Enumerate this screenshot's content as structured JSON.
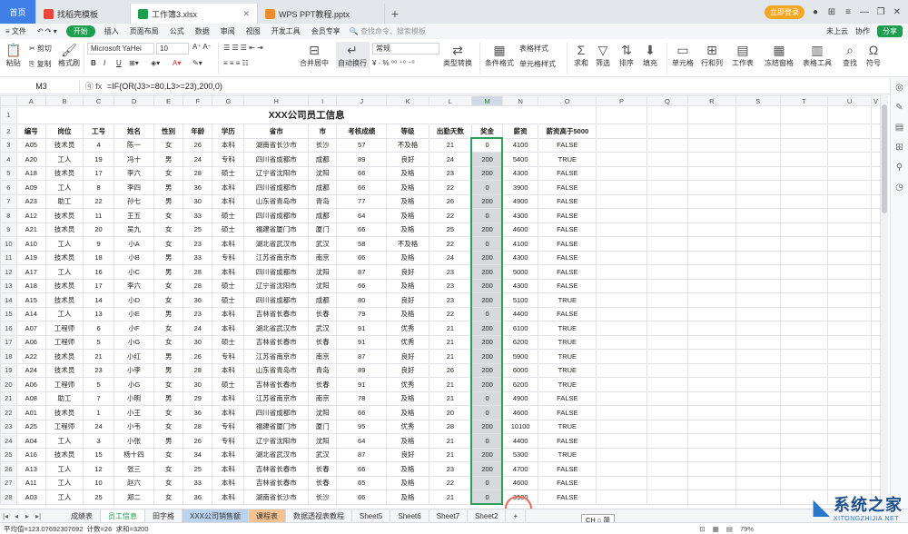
{
  "tabs": [
    {
      "label": "首页",
      "type": "home"
    },
    {
      "label": "找稻壳模板",
      "type": "doc",
      "color": "#e8453c"
    },
    {
      "label": "工作簿3.xlsx",
      "type": "sheet",
      "color": "#1e9e4f",
      "active": true
    },
    {
      "label": "WPS PPT教程.pptx",
      "type": "ppt",
      "color": "#f28b2b"
    }
  ],
  "new_tab": "+",
  "top_right": {
    "login": "立即登录",
    "icons": [
      "⊞",
      "≡",
      "—",
      "❐",
      "✕"
    ]
  },
  "menubar": {
    "file": "≡ 文件",
    "items": [
      "开始",
      "插入",
      "页面布局",
      "公式",
      "数据",
      "审阅",
      "视图",
      "开发工具",
      "会员专享"
    ],
    "search": "🔍 查找命令、搜索模板",
    "right": [
      "未上云",
      "协作",
      "分享"
    ]
  },
  "ribbon": {
    "paste": "粘贴",
    "cut": "✂ 剪切",
    "copy": "⎘ 复制",
    "format_painter": "格式刷",
    "font": "Microsoft YaHei",
    "size": "10",
    "bold": "B",
    "italic": "I",
    "underline": "U",
    "merge": "合并居中",
    "wrap": "自动换行",
    "numfmt": "常规",
    "pct": "¥ · % ⁰⁰ ⁺⁰ ⁻⁰",
    "convert": "类型转换",
    "cond": "条件格式",
    "cellstyle": "表格样式",
    "cellstyle2": "单元格样式",
    "sum": "求和",
    "filter": "筛选",
    "sort": "排序",
    "fill": "填充",
    "cell": "单元格",
    "rowcol": "行和列",
    "worksheet": "工作表",
    "freeze": "冻结窗格",
    "tabletools": "表格工具",
    "find": "查找",
    "symbol": "符号"
  },
  "formula_bar": {
    "name_box": "M3",
    "fx": "ⓠ  fx",
    "formula": "=IF(OR(J3>=80,L3>=23),200,0)"
  },
  "columns": [
    "A",
    "B",
    "C",
    "D",
    "E",
    "F",
    "G",
    "H",
    "I",
    "J",
    "K",
    "L",
    "M",
    "N",
    "O",
    "P",
    "Q",
    "R",
    "S",
    "T",
    "U",
    "V"
  ],
  "title": "XXX公司员工信息",
  "headers": [
    "编号",
    "岗位",
    "工号",
    "姓名",
    "性别",
    "年龄",
    "学历",
    "省市",
    "市",
    "考核成绩",
    "等级",
    "出勤天数",
    "奖金",
    "薪资",
    "薪资高于5000"
  ],
  "rows": [
    [
      "A05",
      "技术员",
      "4",
      "陈一",
      "女",
      "26",
      "本科",
      "湖南省长沙市",
      "长沙",
      "57",
      "不及格",
      "21",
      "0",
      "4100",
      "FALSE"
    ],
    [
      "A20",
      "工人",
      "19",
      "冯十",
      "男",
      "24",
      "专科",
      "四川省成都市",
      "成都",
      "89",
      "良好",
      "24",
      "200",
      "5400",
      "TRUE"
    ],
    [
      "A18",
      "技术员",
      "17",
      "李六",
      "女",
      "28",
      "硕士",
      "辽宁省沈阳市",
      "沈阳",
      "66",
      "及格",
      "23",
      "200",
      "4300",
      "FALSE"
    ],
    [
      "A09",
      "工人",
      "8",
      "李四",
      "男",
      "36",
      "本科",
      "四川省成都市",
      "成都",
      "66",
      "及格",
      "22",
      "0",
      "3900",
      "FALSE"
    ],
    [
      "A23",
      "助工",
      "22",
      "孙七",
      "男",
      "30",
      "本科",
      "山东省青岛市",
      "青岛",
      "77",
      "及格",
      "26",
      "200",
      "4900",
      "FALSE"
    ],
    [
      "A12",
      "技术员",
      "11",
      "王五",
      "女",
      "33",
      "硕士",
      "四川省成都市",
      "成都",
      "64",
      "及格",
      "22",
      "0",
      "4300",
      "FALSE"
    ],
    [
      "A21",
      "技术员",
      "20",
      "吴九",
      "女",
      "25",
      "硕士",
      "福建省厦门市",
      "厦门",
      "66",
      "及格",
      "25",
      "200",
      "4600",
      "FALSE"
    ],
    [
      "A10",
      "工人",
      "9",
      "小A",
      "女",
      "23",
      "本科",
      "湖北省武汉市",
      "武汉",
      "58",
      "不及格",
      "22",
      "0",
      "4100",
      "FALSE"
    ],
    [
      "A19",
      "技术员",
      "18",
      "小B",
      "男",
      "33",
      "专科",
      "江苏省南京市",
      "南京",
      "66",
      "及格",
      "24",
      "200",
      "4300",
      "FALSE"
    ],
    [
      "A17",
      "工人",
      "16",
      "小C",
      "男",
      "28",
      "本科",
      "四川省成都市",
      "沈阳",
      "87",
      "良好",
      "23",
      "200",
      "5000",
      "FALSE"
    ],
    [
      "A18",
      "技术员",
      "17",
      "李六",
      "女",
      "28",
      "硕士",
      "辽宁省沈阳市",
      "沈阳",
      "66",
      "及格",
      "23",
      "200",
      "4300",
      "FALSE"
    ],
    [
      "A15",
      "技术员",
      "14",
      "小D",
      "女",
      "36",
      "硕士",
      "四川省成都市",
      "成都",
      "80",
      "良好",
      "23",
      "200",
      "5100",
      "TRUE"
    ],
    [
      "A14",
      "工人",
      "13",
      "小E",
      "男",
      "23",
      "本科",
      "吉林省长春市",
      "长春",
      "79",
      "及格",
      "22",
      "0",
      "4400",
      "FALSE"
    ],
    [
      "A07",
      "工程师",
      "6",
      "小F",
      "女",
      "24",
      "本科",
      "湖北省武汉市",
      "武汉",
      "91",
      "优秀",
      "21",
      "200",
      "6100",
      "TRUE"
    ],
    [
      "A06",
      "工程师",
      "5",
      "小G",
      "女",
      "30",
      "硕士",
      "吉林省长春市",
      "长春",
      "91",
      "优秀",
      "21",
      "200",
      "6200",
      "TRUE"
    ],
    [
      "A22",
      "技术员",
      "21",
      "小红",
      "男",
      "26",
      "专科",
      "江苏省南京市",
      "南京",
      "87",
      "良好",
      "21",
      "200",
      "5900",
      "TRUE"
    ],
    [
      "A24",
      "技术员",
      "23",
      "小李",
      "男",
      "28",
      "本科",
      "山东省青岛市",
      "青岛",
      "89",
      "良好",
      "26",
      "200",
      "6000",
      "TRUE"
    ],
    [
      "A06",
      "工程师",
      "5",
      "小G",
      "女",
      "30",
      "硕士",
      "吉林省长春市",
      "长春",
      "91",
      "优秀",
      "21",
      "200",
      "6200",
      "TRUE"
    ],
    [
      "A08",
      "助工",
      "7",
      "小明",
      "男",
      "29",
      "本科",
      "江苏省南京市",
      "南京",
      "78",
      "及格",
      "21",
      "0",
      "4900",
      "FALSE"
    ],
    [
      "A01",
      "技术员",
      "1",
      "小王",
      "女",
      "36",
      "本科",
      "四川省成都市",
      "沈阳",
      "66",
      "及格",
      "20",
      "0",
      "4600",
      "FALSE"
    ],
    [
      "A25",
      "工程师",
      "24",
      "小韦",
      "女",
      "28",
      "专科",
      "福建省厦门市",
      "厦门",
      "95",
      "优秀",
      "28",
      "200",
      "10100",
      "TRUE"
    ],
    [
      "A04",
      "工人",
      "3",
      "小张",
      "男",
      "26",
      "专科",
      "辽宁省沈阳市",
      "沈阳",
      "64",
      "及格",
      "21",
      "0",
      "4400",
      "FALSE"
    ],
    [
      "A16",
      "技术员",
      "15",
      "杨十四",
      "女",
      "34",
      "本科",
      "湖北省武汉市",
      "武汉",
      "87",
      "良好",
      "21",
      "200",
      "5300",
      "TRUE"
    ],
    [
      "A13",
      "工人",
      "12",
      "张三",
      "女",
      "25",
      "本科",
      "吉林省长春市",
      "长春",
      "66",
      "及格",
      "23",
      "200",
      "4700",
      "FALSE"
    ],
    [
      "A11",
      "工人",
      "10",
      "赵六",
      "女",
      "33",
      "本科",
      "吉林省长春市",
      "长春",
      "65",
      "及格",
      "22",
      "0",
      "4600",
      "FALSE"
    ],
    [
      "A03",
      "工人",
      "25",
      "郑二",
      "女",
      "36",
      "本科",
      "湖南省长沙市",
      "长沙",
      "66",
      "及格",
      "21",
      "0",
      "3900",
      "FALSE"
    ]
  ],
  "sheet_tabs": [
    "成绩表",
    "员工信息",
    "田字格",
    "XXX公司销售额",
    "课程表",
    "数据透视表教程",
    "Sheet5",
    "Sheet6",
    "Sheet7",
    "Sheet2"
  ],
  "ime": "CH ⌂ 简",
  "status": {
    "avg": "平均值=123.07692307692",
    "count": "计数=26",
    "sum": "求和=3200",
    "zoom": "79%"
  },
  "watermark": {
    "title": "系统之家",
    "url": "XITONGZHIJIA.NET"
  },
  "colors": {
    "accent": "#1e9e4f",
    "home": "#3f7fe8",
    "highlight": "#d7d9dc",
    "selection_border": "#2e9e5a"
  }
}
